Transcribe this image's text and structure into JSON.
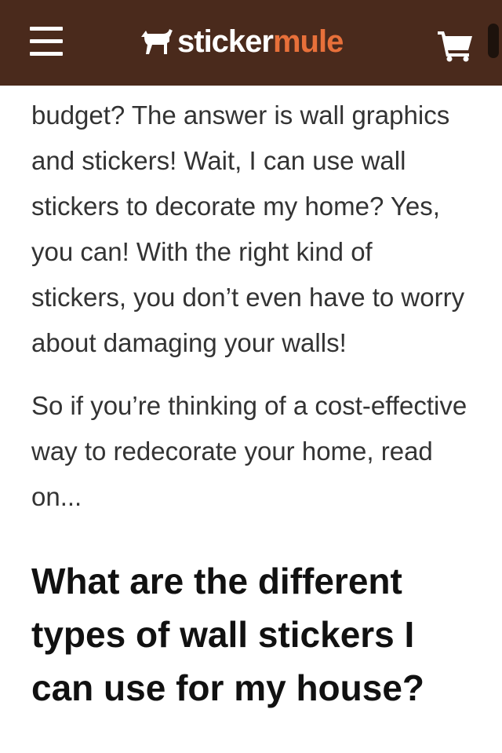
{
  "header": {
    "logo_text_1": "sticker",
    "logo_text_2": "mule",
    "icons": [
      "menu-icon",
      "mule-logo-icon",
      "cart-icon"
    ],
    "colors": {
      "background": "#4a2a1c",
      "accent": "#e8703a"
    }
  },
  "article": {
    "paragraph_1": "budget? The answer is wall graphics and stickers! Wait, I can use wall stickers to decorate my home? Yes, you can! With the right kind of stickers, you don’t even have to worry about damaging your walls!",
    "paragraph_2": "So if you’re thinking of a cost-effective way to redecorate your home, read on...",
    "heading": "What are the different types of wall stickers I can use for my house?"
  }
}
